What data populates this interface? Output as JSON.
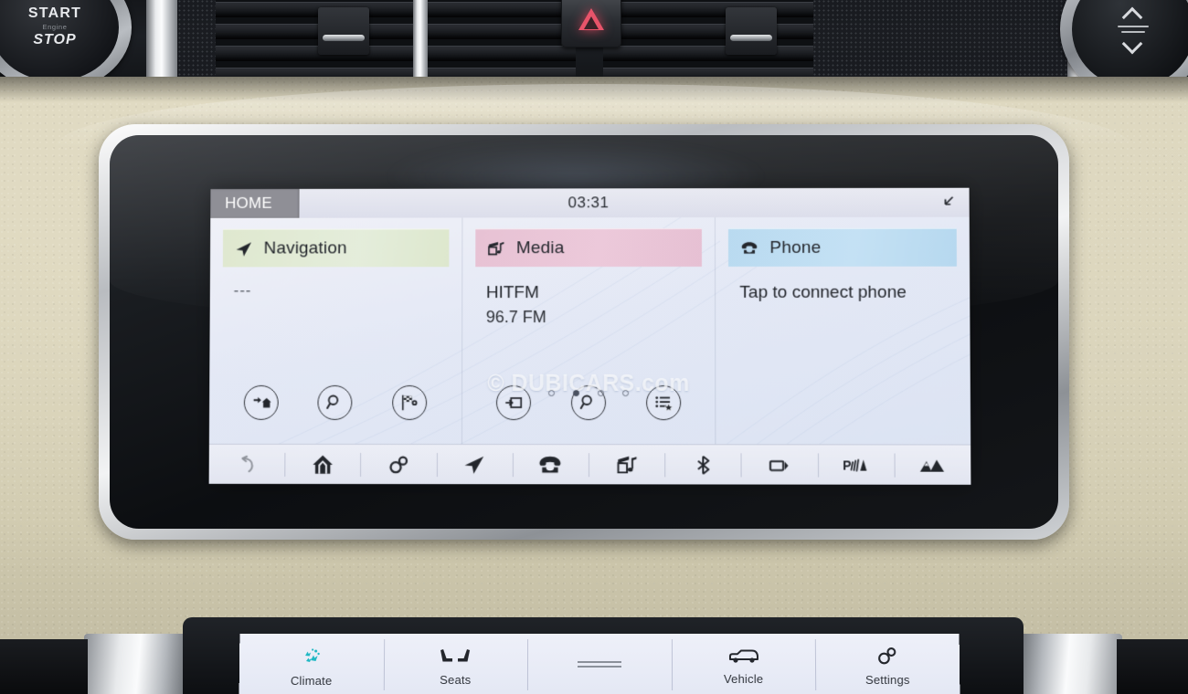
{
  "vehicle_controls": {
    "engine_button": {
      "start_label": "START",
      "mid_label": "Engine",
      "stop_label": "STOP"
    },
    "hazard_button_name": "hazard-warning-button",
    "rotary_knob_name": "volume-tune-knob"
  },
  "ivi": {
    "header": {
      "home_tab": "HOME",
      "clock": "03:31",
      "collapse_icon": "collapse-arrow-icon"
    },
    "panels": [
      {
        "id": "navigation",
        "title": "Navigation",
        "icon": "navigation-arrow-icon",
        "header_color": "#e2ebd3",
        "line1": "---",
        "line2": "",
        "shortcuts": [
          {
            "name": "go-home-icon",
            "label": "Go home"
          },
          {
            "name": "search-icon",
            "label": "Search destination"
          },
          {
            "name": "destination-flag-icon",
            "label": "Recent destinations"
          }
        ]
      },
      {
        "id": "media",
        "title": "Media",
        "icon": "media-note-icon",
        "header_color": "#e9c5d7",
        "line1": "HITFM",
        "line2": "96.7 FM",
        "shortcuts": [
          {
            "name": "media-source-icon",
            "label": "Source"
          },
          {
            "name": "search-icon",
            "label": "Search media"
          },
          {
            "name": "favourites-list-icon",
            "label": "Favourites"
          }
        ]
      },
      {
        "id": "phone",
        "title": "Phone",
        "icon": "telephone-icon",
        "header_color": "#bedcf1",
        "line1": "Tap to connect phone",
        "line2": "",
        "shortcuts": []
      }
    ],
    "watermark": "© DUBICARS.com",
    "page_dots": {
      "total": 4,
      "active_index": 1
    },
    "navbar": [
      {
        "name": "back-icon",
        "label": "Back"
      },
      {
        "name": "home-icon",
        "label": "Home"
      },
      {
        "name": "settings-gears-icon",
        "label": "Settings"
      },
      {
        "name": "navigation-arrow-icon",
        "label": "Navigation"
      },
      {
        "name": "telephone-icon",
        "label": "Phone"
      },
      {
        "name": "media-note-icon",
        "label": "Media"
      },
      {
        "name": "bluetooth-icon",
        "label": "Bluetooth"
      },
      {
        "name": "camera-icon",
        "label": "Camera"
      },
      {
        "name": "park-assist-icon",
        "label": "Park assist"
      },
      {
        "name": "terrain-icon",
        "label": "Terrain response"
      }
    ]
  },
  "lower_panel": {
    "buttons": [
      {
        "name": "climate-button",
        "label": "Climate",
        "icon": "climate-airflow-icon",
        "icon_color": "#1fb8c4"
      },
      {
        "name": "seats-button",
        "label": "Seats",
        "icon": "seats-icon",
        "icon_color": "#23262c"
      },
      {
        "name": "divider-button",
        "label": "",
        "icon": "two-lines-icon",
        "icon_color": "#7d828c"
      },
      {
        "name": "vehicle-button",
        "label": "Vehicle",
        "icon": "vehicle-car-icon",
        "icon_color": "#23262c"
      },
      {
        "name": "settings-button",
        "label": "Settings",
        "icon": "settings-gears-icon",
        "icon_color": "#23262c"
      }
    ]
  },
  "colors": {
    "nav_green": "#e2ebd3",
    "media_pink": "#e9c5d7",
    "phone_blue": "#bedcf1",
    "screen_bg": "#e5eaf5",
    "home_tab_grey": "#8f8f96",
    "climate_teal": "#1fb8c4"
  }
}
